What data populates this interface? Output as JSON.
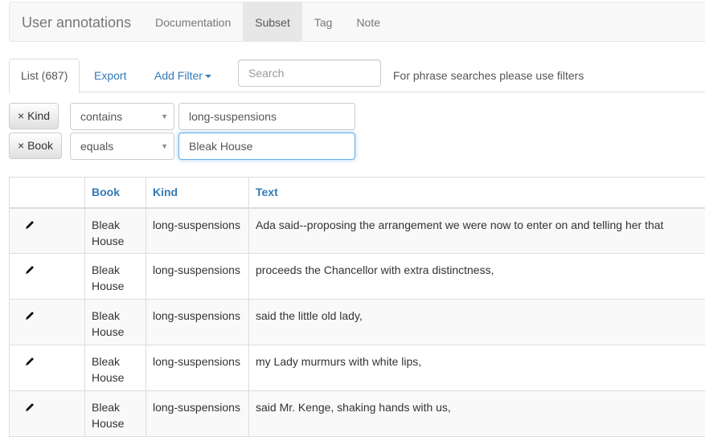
{
  "navbar": {
    "brand": "User annotations",
    "items": [
      "Documentation",
      "Subset",
      "Tag",
      "Note"
    ],
    "active": "Subset"
  },
  "tabs": {
    "list_label": "List (687)",
    "export_label": "Export",
    "add_filter_label": "Add Filter"
  },
  "search": {
    "placeholder": "Search",
    "value": ""
  },
  "phrase_hint": "For phrase searches please use filters",
  "filters": [
    {
      "remove_label": "× Kind",
      "operator": "contains",
      "value": "long-suspensions",
      "focused": false
    },
    {
      "remove_label": "× Book",
      "operator": "equals",
      "value": "Bleak House",
      "focused": true
    }
  ],
  "table": {
    "headers": [
      "",
      "Book",
      "Kind",
      "Text"
    ],
    "rows": [
      {
        "book": "Bleak House",
        "kind": "long-suspensions",
        "text": "Ada said--proposing the arrangement we were now to enter on and telling her that"
      },
      {
        "book": "Bleak House",
        "kind": "long-suspensions",
        "text": "proceeds the Chancellor with extra distinctness,"
      },
      {
        "book": "Bleak House",
        "kind": "long-suspensions",
        "text": "said the little old lady,"
      },
      {
        "book": "Bleak House",
        "kind": "long-suspensions",
        "text": "my Lady murmurs with white lips,"
      },
      {
        "book": "Bleak House",
        "kind": "long-suspensions",
        "text": "said Mr. Kenge, shaking hands with us,"
      }
    ]
  },
  "icons": {
    "edit": "pencil-icon",
    "dropdown": "caret-down-icon"
  },
  "colors": {
    "link": "#337ab7",
    "focus_border": "#66afe9",
    "navbar_bg": "#f8f8f8",
    "active_nav_bg": "#e7e7e7"
  }
}
